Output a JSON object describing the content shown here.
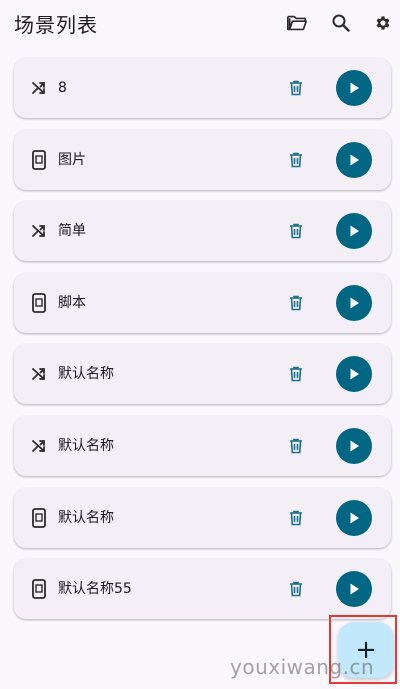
{
  "header": {
    "title": "场景列表",
    "icons": [
      "folder-open-icon",
      "search-icon",
      "gear-icon"
    ]
  },
  "scenes": [
    {
      "name": "8",
      "type_icon": "shuffle-icon"
    },
    {
      "name": "图片",
      "type_icon": "phone-icon"
    },
    {
      "name": "简单",
      "type_icon": "shuffle-icon"
    },
    {
      "name": "脚本",
      "type_icon": "phone-icon"
    },
    {
      "name": "默认名称",
      "type_icon": "shuffle-icon"
    },
    {
      "name": "默认名称",
      "type_icon": "shuffle-icon"
    },
    {
      "name": "默认名称",
      "type_icon": "phone-icon"
    },
    {
      "name": "默认名称55",
      "type_icon": "phone-icon"
    }
  ],
  "fab": {
    "label": "+",
    "icon": "add-icon"
  },
  "watermark": "youxiwang.cn",
  "colors": {
    "background": "#fbf8fd",
    "card": "#f4eef6",
    "accent": "#006684",
    "delete_icon": "#1d6f8c",
    "fab": "#c2e8fb",
    "highlight": "#e53935"
  }
}
